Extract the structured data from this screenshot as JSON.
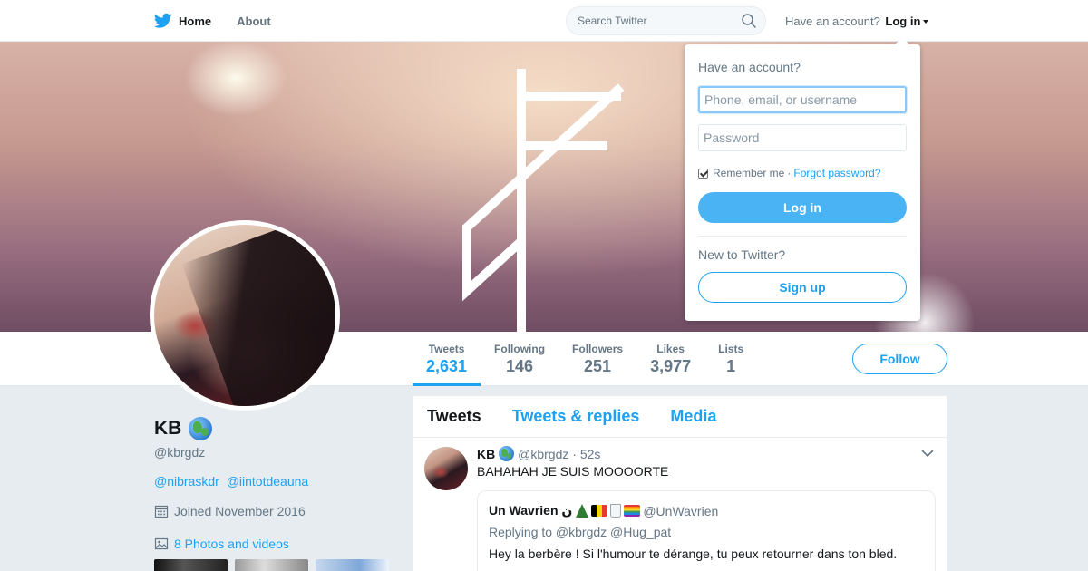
{
  "colors": {
    "accent": "#1da1f2",
    "text": "#14171a",
    "muted": "#657786",
    "background": "#e6ecf0"
  },
  "nav": {
    "home_label": "Home",
    "about_label": "About",
    "search_placeholder": "Search Twitter",
    "have_account": "Have an account?",
    "login_label": "Log in",
    "icons": [
      "twitter-bird-icon",
      "search-icon",
      "caret-down-icon"
    ]
  },
  "profile": {
    "name": "KB",
    "name_emoji": "globe-icon",
    "handle": "@kbrgdz",
    "bio_mentions": [
      "@nibraskdr",
      "@iintotdeauna"
    ],
    "joined": "Joined November 2016",
    "photos_link": "8 Photos and videos"
  },
  "stats": [
    {
      "label": "Tweets",
      "value": "2,631",
      "active": true
    },
    {
      "label": "Following",
      "value": "146"
    },
    {
      "label": "Followers",
      "value": "251"
    },
    {
      "label": "Likes",
      "value": "3,977"
    },
    {
      "label": "Lists",
      "value": "1"
    }
  ],
  "follow_label": "Follow",
  "timeline": {
    "tabs": [
      {
        "label": "Tweets",
        "active": true
      },
      {
        "label": "Tweets & replies"
      },
      {
        "label": "Media"
      }
    ],
    "tweet": {
      "name": "KB",
      "handle": "@kbrgdz",
      "separator": "·",
      "time": "52s",
      "text": "BAHAHAH JE SUIS MOOOORTE",
      "quote": {
        "name": "Un Wavrien ن",
        "emojis": [
          "tree",
          "belgian-flag",
          "beer-glass",
          "rainbow-flag"
        ],
        "handle": "@UnWavrien",
        "replying_to": "Replying to @kbrgdz @Hug_pat",
        "text": "Hey la berbère ! Si l'humour te dérange, tu peux retourner dans ton bled."
      }
    }
  },
  "login_dropdown": {
    "title": "Have an account?",
    "username_placeholder": "Phone, email, or username",
    "password_placeholder": "Password",
    "remember_label": "Remember me",
    "separator": "·",
    "forgot_label": "Forgot password?",
    "login_button": "Log in",
    "new_label": "New to Twitter?",
    "signup_button": "Sign up"
  }
}
